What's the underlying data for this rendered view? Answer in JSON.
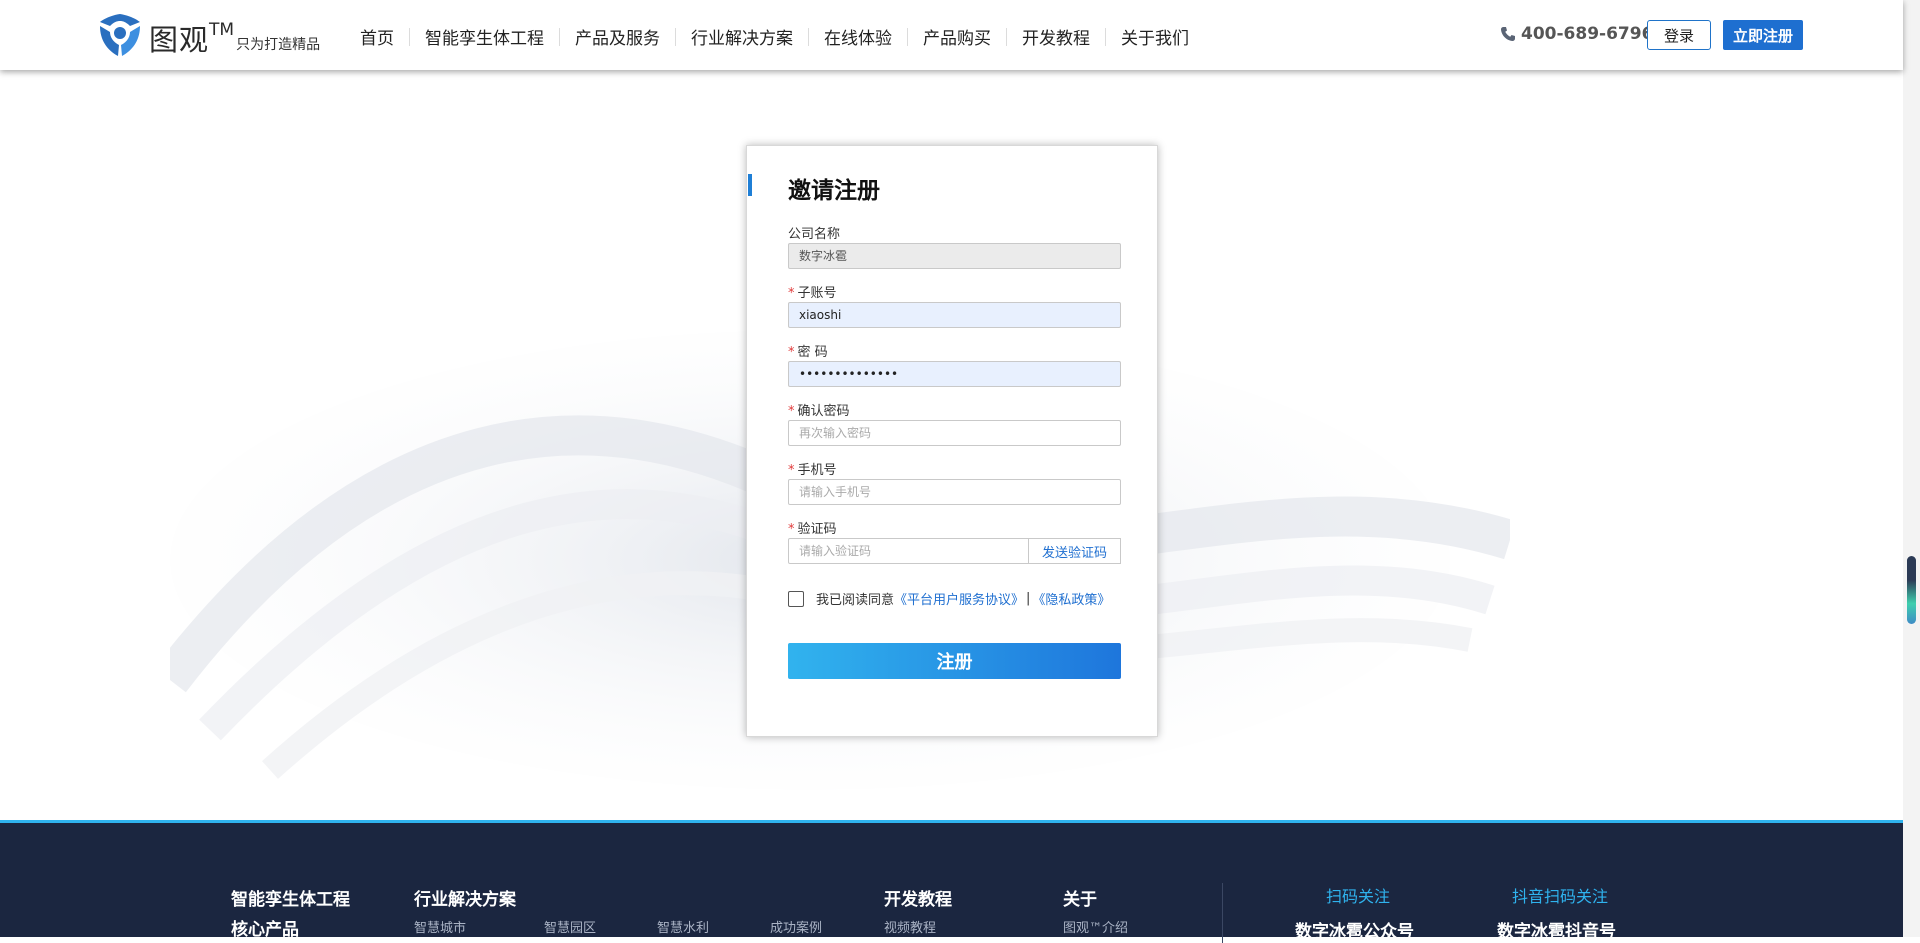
{
  "header": {
    "logo_name": "图观",
    "logo_tm": "TM",
    "logo_slogan": "只为打造精品",
    "nav": [
      "首页",
      "智能孪生体工程",
      "产品及服务",
      "行业解决方案",
      "在线体验",
      "产品购买",
      "开发教程",
      "关于我们"
    ],
    "hotline": "400-689-6796",
    "login_label": "登录",
    "register_label": "立即注册"
  },
  "form": {
    "title": "邀请注册",
    "company": {
      "label": "公司名称",
      "value": "数字冰雹"
    },
    "sub_account": {
      "label": "子账号",
      "value": "xiaoshi"
    },
    "password": {
      "label": "密 码",
      "value": "••••••••••••••"
    },
    "confirm_password": {
      "label": "确认密码",
      "placeholder": "再次输入密码"
    },
    "phone": {
      "label": "手机号",
      "placeholder": "请输入手机号"
    },
    "code": {
      "label": "验证码",
      "placeholder": "请输入验证码",
      "send_label": "发送验证码"
    },
    "agree": {
      "text": "我已阅读同意",
      "service_link": "《平台用户服务协议》",
      "separator": "|",
      "privacy_link": "《隐私政策》"
    },
    "submit_label": "注册",
    "required_mark": "*"
  },
  "footer": {
    "col1_title": "智能孪生体工程",
    "col1_sub": "核心产品",
    "col2_title": "行业解决方案",
    "col2_links": [
      "智慧城市",
      "智慧园区",
      "智慧水利",
      "成功案例"
    ],
    "col3_title": "开发教程",
    "col3_links": [
      "视频教程"
    ],
    "col4_title": "关于",
    "col4_links": [
      "图观™介绍"
    ],
    "qr1_title": "扫码关注",
    "qr1_name": "数字冰雹公众号",
    "qr2_title": "抖音扫码关注",
    "qr2_name": "数字冰雹抖音号"
  },
  "colors": {
    "accent": "#1e6fd0",
    "footer_bg": "#1b2640",
    "footer_accent": "#2fb3ee",
    "required": "#e03a3a"
  },
  "icons": [
    "logo-icon",
    "phone-icon",
    "checkbox"
  ]
}
